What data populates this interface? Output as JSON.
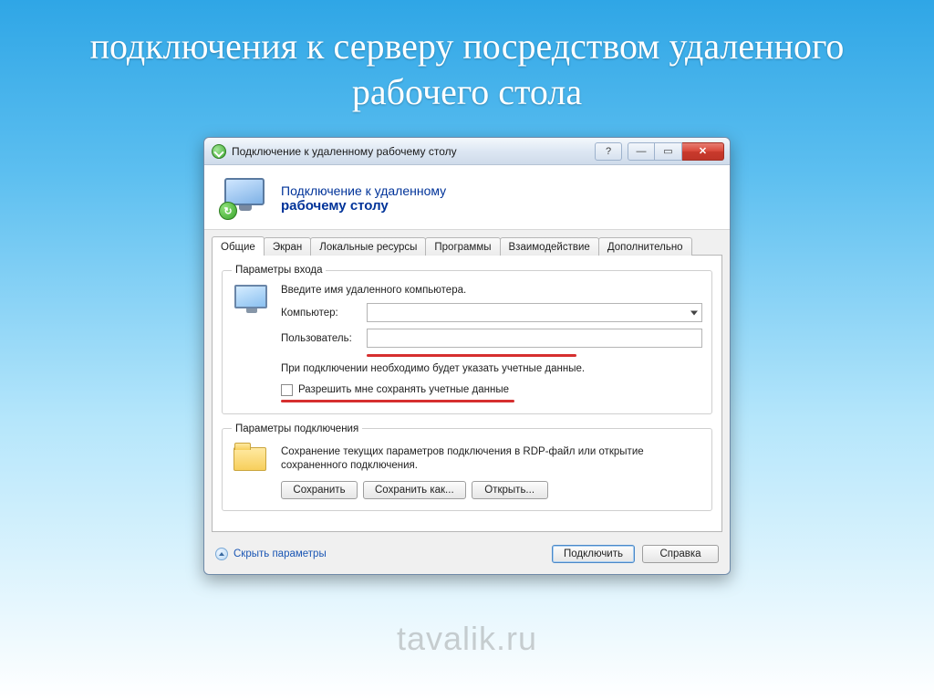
{
  "slide": {
    "title": "подключения к серверу посредством удаленного рабочего стола"
  },
  "window": {
    "title": "Подключение к удаленному рабочему столу",
    "banner_line1": "Подключение к удаленному",
    "banner_line2": "рабочему столу"
  },
  "tabs": [
    {
      "label": "Общие",
      "active": true
    },
    {
      "label": "Экран",
      "active": false
    },
    {
      "label": "Локальные ресурсы",
      "active": false
    },
    {
      "label": "Программы",
      "active": false
    },
    {
      "label": "Взаимодействие",
      "active": false
    },
    {
      "label": "Дополнительно",
      "active": false
    }
  ],
  "login_group": {
    "legend": "Параметры входа",
    "hint": "Введите имя удаленного компьютера.",
    "computer_label": "Компьютер:",
    "computer_value": "",
    "user_label": "Пользователь:",
    "user_value": "",
    "note": "При подключении необходимо будет указать учетные данные.",
    "checkbox_label": "Разрешить мне сохранять учетные данные"
  },
  "conn_group": {
    "legend": "Параметры подключения",
    "note": "Сохранение текущих параметров подключения в RDP-файл или открытие сохраненного подключения.",
    "save": "Сохранить",
    "save_as": "Сохранить как...",
    "open": "Открыть..."
  },
  "footer": {
    "hide_params": "Скрыть параметры",
    "connect": "Подключить",
    "help": "Справка"
  },
  "watermark": "tavalik.ru"
}
